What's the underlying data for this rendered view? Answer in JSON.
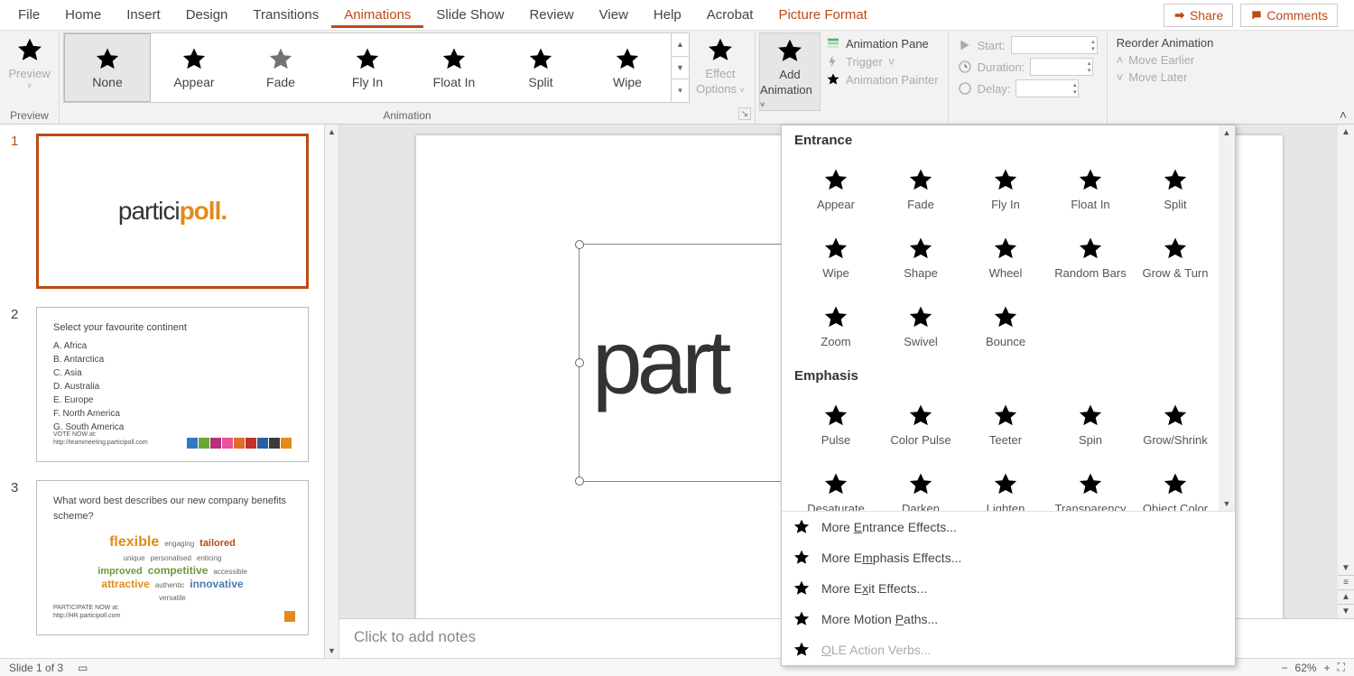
{
  "menu": {
    "items": [
      "File",
      "Home",
      "Insert",
      "Design",
      "Transitions",
      "Animations",
      "Slide Show",
      "Review",
      "View",
      "Help",
      "Acrobat",
      "Picture Format"
    ],
    "activeIndex": 5,
    "share": "Share",
    "comments": "Comments"
  },
  "ribbon": {
    "preview": {
      "label": "Preview",
      "group": "Preview"
    },
    "animationGroupLabel": "Animation",
    "gallery": [
      "None",
      "Appear",
      "Fade",
      "Fly In",
      "Float In",
      "Split",
      "Wipe"
    ],
    "effectOptions": {
      "top": "Effect",
      "bottom": "Options"
    },
    "addAnimation": {
      "top": "Add",
      "bottom": "Animation"
    },
    "advanced": {
      "pane": "Animation Pane",
      "trigger": "Trigger",
      "painter": "Animation Painter"
    },
    "timing": {
      "start": "Start:",
      "duration": "Duration:",
      "delay": "Delay:"
    },
    "reorder": {
      "title": "Reorder Animation",
      "earlier": "Move Earlier",
      "later": "Move Later"
    }
  },
  "thumbs": {
    "logo_html_prefix": "partici",
    "logo_html_bold": "poll",
    "logo_html_suffix": ".",
    "s2": {
      "title": "Select your favourite continent",
      "opts": [
        "A.  Africa",
        "B.  Antarctica",
        "C.  Asia",
        "D.  Australia",
        "E.  Europe",
        "F.  North America",
        "G.  South America"
      ],
      "foot1": "VOTE NOW at:",
      "foot2": "http://teammeeting.participoll.com"
    },
    "s3": {
      "title": "What word best describes our new company benefits scheme?",
      "words": [
        {
          "t": "flexible",
          "c": "#e28a1c",
          "s": 16,
          "w": "bold"
        },
        {
          "t": "engaging",
          "c": "#666",
          "s": 8
        },
        {
          "t": "tailored",
          "c": "#bc4b13",
          "s": 11,
          "w": "bold"
        },
        {
          "t": "unique",
          "c": "#666",
          "s": 8
        },
        {
          "t": "personalised",
          "c": "#666",
          "s": 8
        },
        {
          "t": "enticing",
          "c": "#666",
          "s": 8
        },
        {
          "t": "improved",
          "c": "#6a9a3a",
          "s": 11,
          "w": "bold"
        },
        {
          "t": "competitive",
          "c": "#6a9a3a",
          "s": 12,
          "w": "bold"
        },
        {
          "t": "accessible",
          "c": "#666",
          "s": 8
        },
        {
          "t": "attractive",
          "c": "#e28a1c",
          "s": 12,
          "w": "bold"
        },
        {
          "t": "authentic",
          "c": "#666",
          "s": 8
        },
        {
          "t": "innovative",
          "c": "#4a7bb0",
          "s": 12,
          "w": "bold"
        },
        {
          "t": "versatile",
          "c": "#666",
          "s": 8
        }
      ],
      "foot1": "PARTICIPATE NOW at:",
      "foot2": "http://HR.participoll.com"
    },
    "color_row": [
      "#2f78c3",
      "#6aa835",
      "#b33083",
      "#e85298",
      "#e06c2b",
      "#c5302b",
      "#2560a4",
      "#3a3a3a",
      "#e28a1c"
    ]
  },
  "canvas": {
    "logo_text": "part"
  },
  "notes": {
    "placeholder": "Click to add notes"
  },
  "dropdown": {
    "entranceTitle": "Entrance",
    "emphasisTitle": "Emphasis",
    "entrance": [
      "Appear",
      "Fade",
      "Fly In",
      "Float In",
      "Split",
      "Wipe",
      "Shape",
      "Wheel",
      "Random Bars",
      "Grow & Turn",
      "Zoom",
      "Swivel",
      "Bounce"
    ],
    "emphasis": [
      "Pulse",
      "Color Pulse",
      "Teeter",
      "Spin",
      "Grow/Shrink",
      "Desaturate",
      "Darken",
      "Lighten",
      "Transparency",
      "Object Color"
    ],
    "more": [
      {
        "label_pre": "More ",
        "u": "E",
        "label_post": "ntrance Effects...",
        "star": "g"
      },
      {
        "label_pre": "More E",
        "u": "m",
        "label_post": "phasis Effects...",
        "star": "y"
      },
      {
        "label_pre": "More E",
        "u": "x",
        "label_post": "it Effects...",
        "star": "r"
      },
      {
        "label_pre": "More Motion ",
        "u": "P",
        "label_post": "aths...",
        "star": "n"
      },
      {
        "label_pre": "",
        "u": "O",
        "label_post": "LE Action Verbs...",
        "star": "gear",
        "disabled": true
      }
    ]
  },
  "status": {
    "left": "Slide 1 of 3",
    "zoom": "62%"
  }
}
